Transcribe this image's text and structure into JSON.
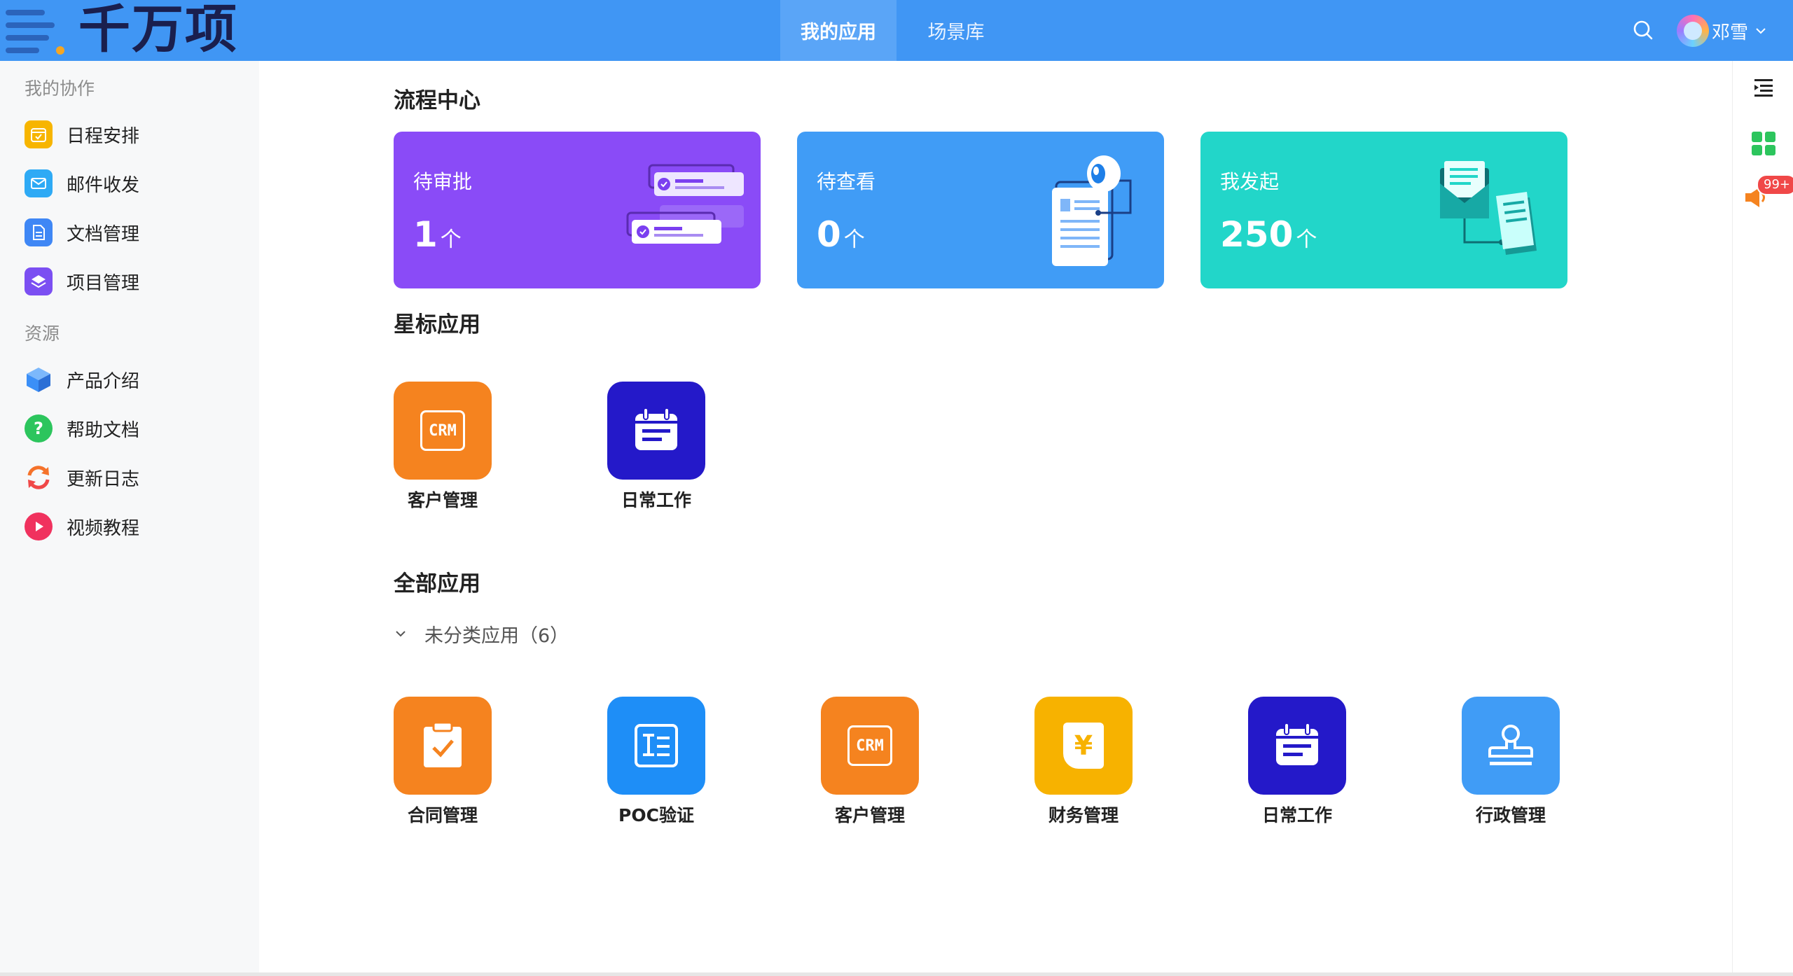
{
  "brand": {
    "name": "千万项",
    "accent_color": "#f5a623"
  },
  "header": {
    "background": "#4096f4",
    "tabs": [
      {
        "label": "我的应用",
        "active": true
      },
      {
        "label": "场景库",
        "active": false
      }
    ],
    "search_icon": "search-icon",
    "user": {
      "name": "邓雪"
    }
  },
  "sidebar": {
    "sections": [
      {
        "title": "我的协作",
        "items": [
          {
            "label": "日程安排",
            "icon": "calendar-icon",
            "color": "#f7b500"
          },
          {
            "label": "邮件收发",
            "icon": "mail-icon",
            "color": "#2eaaf5"
          },
          {
            "label": "文档管理",
            "icon": "document-icon",
            "color": "#3f87f5"
          },
          {
            "label": "项目管理",
            "icon": "layers-icon",
            "color": "#7b4ff2"
          }
        ]
      },
      {
        "title": "资源",
        "items": [
          {
            "label": "产品介绍",
            "icon": "cube-icon",
            "color": "#3b8ff7"
          },
          {
            "label": "帮助文档",
            "icon": "help-icon",
            "color": "#2cc55d"
          },
          {
            "label": "更新日志",
            "icon": "refresh-icon",
            "color": "#f5722a"
          },
          {
            "label": "视频教程",
            "icon": "play-icon",
            "color": "#f0325e"
          }
        ]
      }
    ]
  },
  "process_center": {
    "title": "流程中心",
    "cards": [
      {
        "label": "待审批",
        "count": "1",
        "unit": "个",
        "color": "#8a4bf7"
      },
      {
        "label": "待查看",
        "count": "0",
        "unit": "个",
        "color": "#409cf6"
      },
      {
        "label": "我发起",
        "count": "250",
        "unit": "个",
        "color": "#22d6c9"
      }
    ]
  },
  "starred_apps": {
    "title": "星标应用",
    "apps": [
      {
        "label": "客户管理",
        "icon": "crm-icon",
        "color": "#f5831f",
        "icon_text": "CRM"
      },
      {
        "label": "日常工作",
        "icon": "calendar-list-icon",
        "color": "#2419c9"
      }
    ]
  },
  "all_apps": {
    "title": "全部应用",
    "category": {
      "label": "未分类应用（6）"
    },
    "apps": [
      {
        "label": "合同管理",
        "icon": "clipboard-check-icon",
        "color": "#f5831f"
      },
      {
        "label": "POC验证",
        "icon": "form-icon",
        "color": "#1e8ef7"
      },
      {
        "label": "客户管理",
        "icon": "crm-icon",
        "color": "#f5831f",
        "icon_text": "CRM"
      },
      {
        "label": "财务管理",
        "icon": "yuan-icon",
        "color": "#f7b200",
        "icon_text": "¥"
      },
      {
        "label": "日常工作",
        "icon": "calendar-list-icon",
        "color": "#2419c9"
      },
      {
        "label": "行政管理",
        "icon": "stamp-icon",
        "color": "#409cf6"
      }
    ]
  },
  "right_rail": {
    "notification_badge": "99+"
  }
}
